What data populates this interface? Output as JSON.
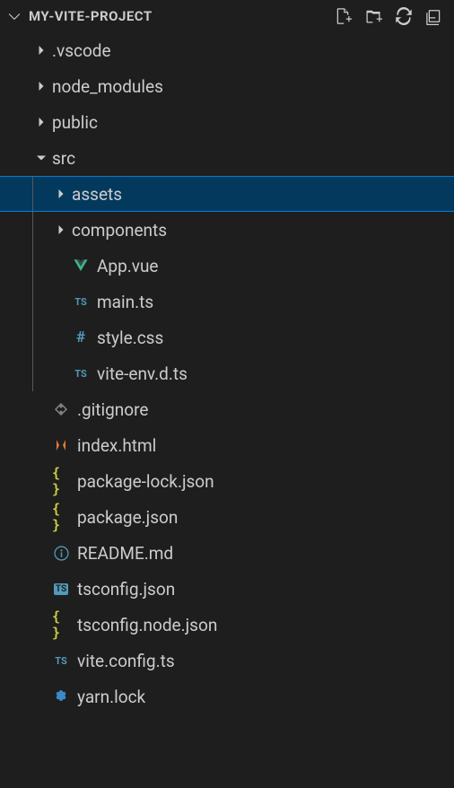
{
  "project_name": "MY-VITE-PROJECT",
  "items": {
    "vscode": ".vscode",
    "node_modules": "node_modules",
    "public": "public",
    "src": "src",
    "assets": "assets",
    "components": "components",
    "app_vue": "App.vue",
    "main_ts": "main.ts",
    "style_css": "style.css",
    "vite_env": "vite-env.d.ts",
    "gitignore": ".gitignore",
    "index_html": "index.html",
    "pkg_lock": "package-lock.json",
    "pkg": "package.json",
    "readme": "README.md",
    "tsconfig": "tsconfig.json",
    "tsconfig_node": "tsconfig.node.json",
    "vite_config": "vite.config.ts",
    "yarn_lock": "yarn.lock"
  }
}
